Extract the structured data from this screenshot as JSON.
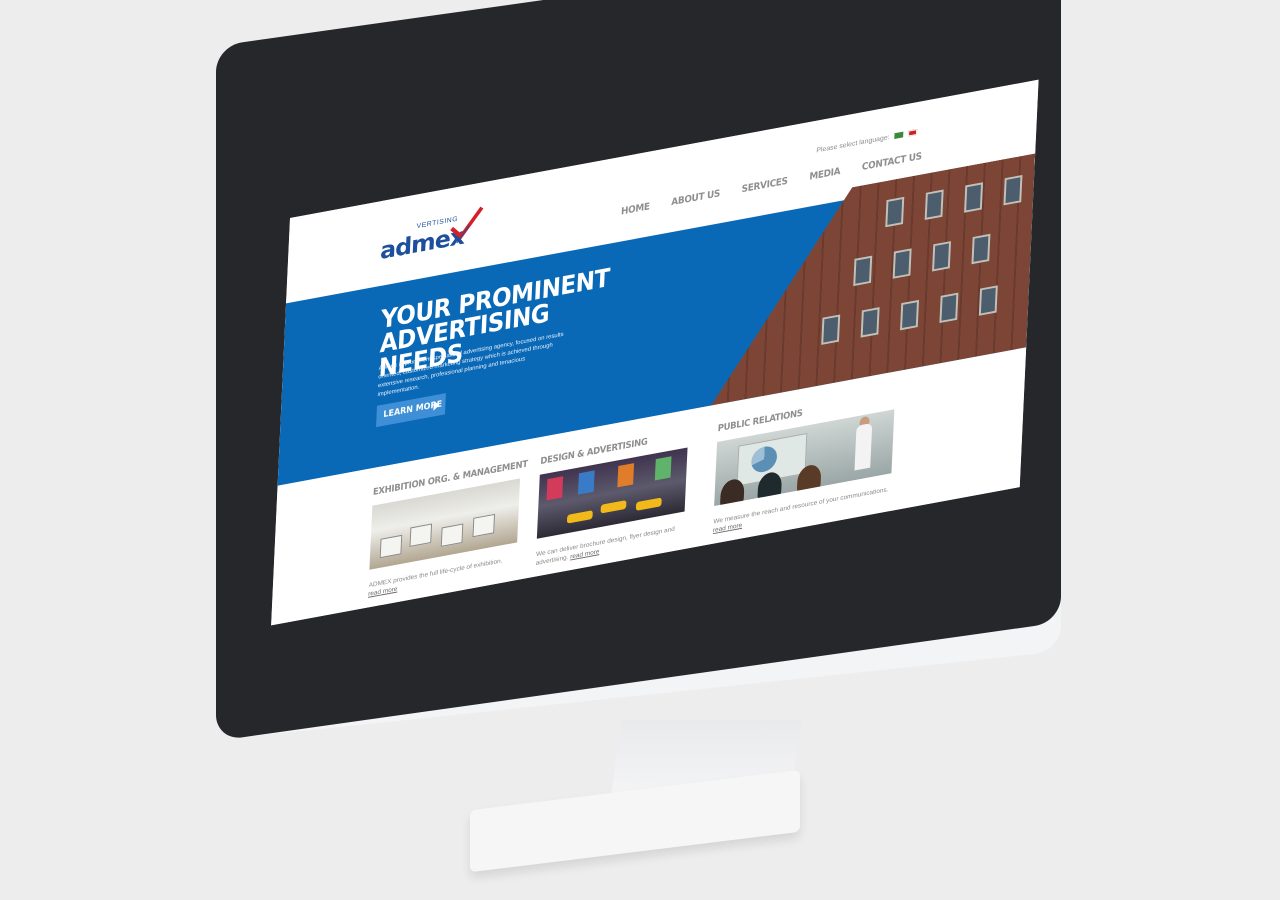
{
  "logo": {
    "name": "admex",
    "tagline": "VERTISING"
  },
  "language": {
    "prompt": "Please select language:",
    "flags": [
      "arabic-flag",
      "uk-flag"
    ]
  },
  "nav": {
    "items": [
      "HOME",
      "ABOUT US",
      "SERVICES",
      "MEDIA",
      "CONTACT US"
    ]
  },
  "hero": {
    "title_line1": "YOUR PROMINENT",
    "title_line2": "ADVERTISING NEEDS",
    "description": "Admex is prominent specialized advertising agency, focused on results oriented, customized marketing strategy which is achieved through extensive research, professional planning and tenacious implementation.",
    "button_label": "LEARN MORE"
  },
  "services": [
    {
      "title": "EXHIBITION ORG. & MANAGEMENT",
      "text": "ADMEX provides the full life-cycle of exhibition.",
      "link": "read more"
    },
    {
      "title": "DESIGN & ADVERTISING",
      "text": "We can deliver brochure design, flyer design and advertising.",
      "link": "read more"
    },
    {
      "title": "PUBLIC RELATIONS",
      "text": "We measure the reach and resource of your communications.",
      "link": "read more"
    }
  ],
  "colors": {
    "brand_blue": "#0a69b7",
    "button_blue": "#3e8fd6",
    "nav_gray": "#8f8f8f",
    "monitor_bezel": "#26272b"
  }
}
